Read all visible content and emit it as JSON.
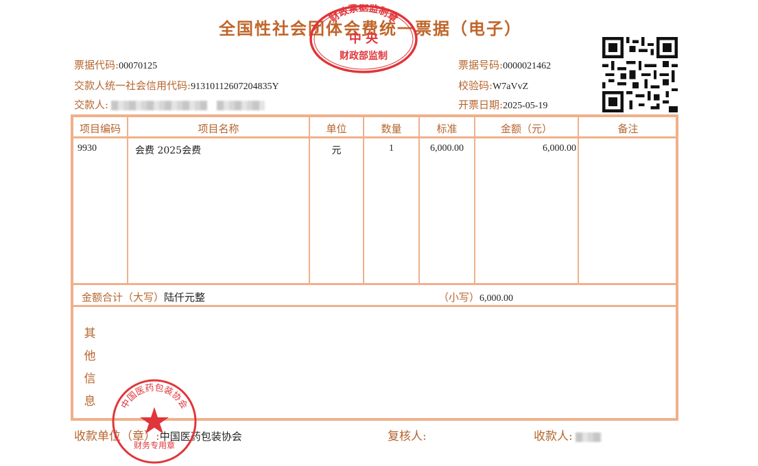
{
  "title": "全国性社会团体会费统一票据（电子）",
  "header": {
    "bill_code_label": "票据代码:",
    "bill_code": "00070125",
    "payer_credit_label": "交款人统一社会信用代码:",
    "payer_credit": "91310112607204835Y",
    "payer_label": "交款人:",
    "bill_no_label": "票据号码:",
    "bill_no": "0000021462",
    "check_code_label": "校验码:",
    "check_code": "W7aVvZ",
    "issue_date_label": "开票日期:",
    "issue_date": "2025-05-19"
  },
  "table": {
    "headers": [
      "项目编码",
      "项目名称",
      "单位",
      "数量",
      "标准",
      "金额（元）",
      "备注"
    ],
    "rows": [
      {
        "code": "9930",
        "name": "会费 2025会费",
        "unit": "元",
        "qty": "1",
        "standard": "6,000.00",
        "amount": "6,000.00",
        "note": ""
      }
    ],
    "total_upper_label": "金额合计（大写）",
    "total_upper": "陆仟元整",
    "total_lower_label": "（小写）",
    "total_lower": "6,000.00",
    "other_info_label": "其他信息"
  },
  "footer": {
    "payee_unit_label": "收款单位（章）:",
    "payee_unit": "中国医药包装协会",
    "reviewer_label": "复核人:",
    "payee_label": "收款人:"
  },
  "stamps": {
    "top": {
      "ring": "财政票据监制章",
      "center": "中 央",
      "bottom": "财政部监制"
    },
    "bottom": {
      "ring": "中国医药包装协会",
      "bottom": "财务专用章"
    }
  },
  "colors": {
    "label": "#b5652e",
    "border": "#f0b08a",
    "stamp": "#e0353a"
  }
}
